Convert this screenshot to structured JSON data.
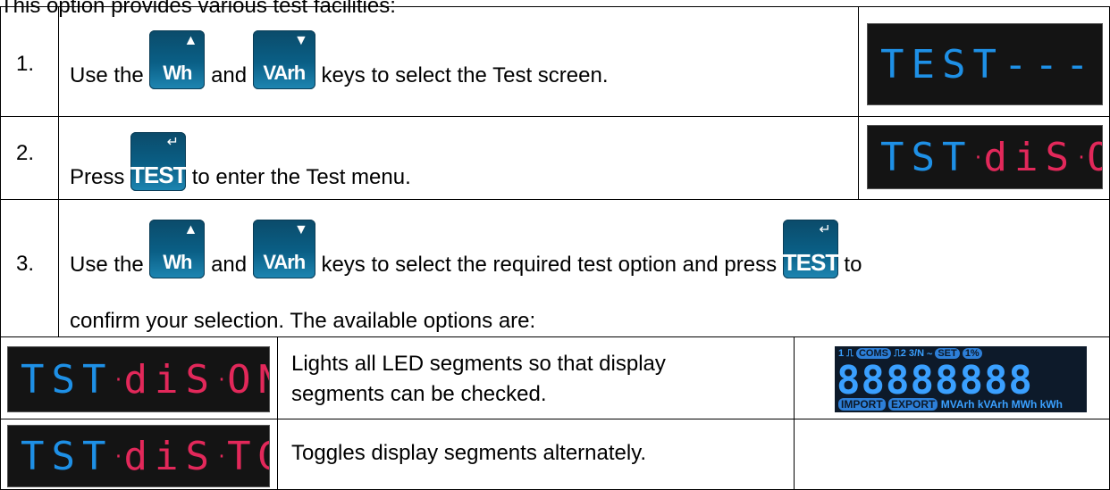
{
  "intro": "This option provides various test facilities:",
  "keys": {
    "wh": "Wh",
    "varh": "VArh",
    "test": "TEST",
    "up_arrow_icon": "up-triangle",
    "down_arrow_icon": "down-triangle",
    "enter_icon": "enter-arrow"
  },
  "steps": [
    {
      "num": "1.",
      "t1": "Use the",
      "t2": "and",
      "t3": "keys to select the Test screen."
    },
    {
      "num": "2.",
      "t1": "Press",
      "t2": "to enter the Test menu."
    },
    {
      "num": "3.",
      "t1": "Use the",
      "t2": "and",
      "t3": "keys to select the required test option and press",
      "t4": "to",
      "line2": "confirm your selection.  The available options are:"
    }
  ],
  "displays": {
    "test_screen": "TEST----",
    "dis_on_a": "TST",
    "dis_on_b": "diS",
    "dis_on_c": "ON",
    "dis_tg_c": "TG"
  },
  "options": [
    {
      "line1": "Lights all LED segments so that display",
      "line2": "segments can be checked."
    },
    {
      "line1": "Toggles display segments alternately."
    }
  ],
  "segment_display": {
    "top": [
      "1",
      "COMS",
      "2",
      "3/N",
      "SET",
      "1%"
    ],
    "digits": "88888888",
    "bottom": [
      "IMPORT",
      "EXPORT",
      "MVArh",
      "kVArh",
      "MWh",
      "kWh"
    ]
  },
  "colors": {
    "key_bg": "#0a5f86",
    "led_blue": "#1e90e6",
    "led_pink": "#e2285a",
    "lcd_bg": "#141414"
  }
}
